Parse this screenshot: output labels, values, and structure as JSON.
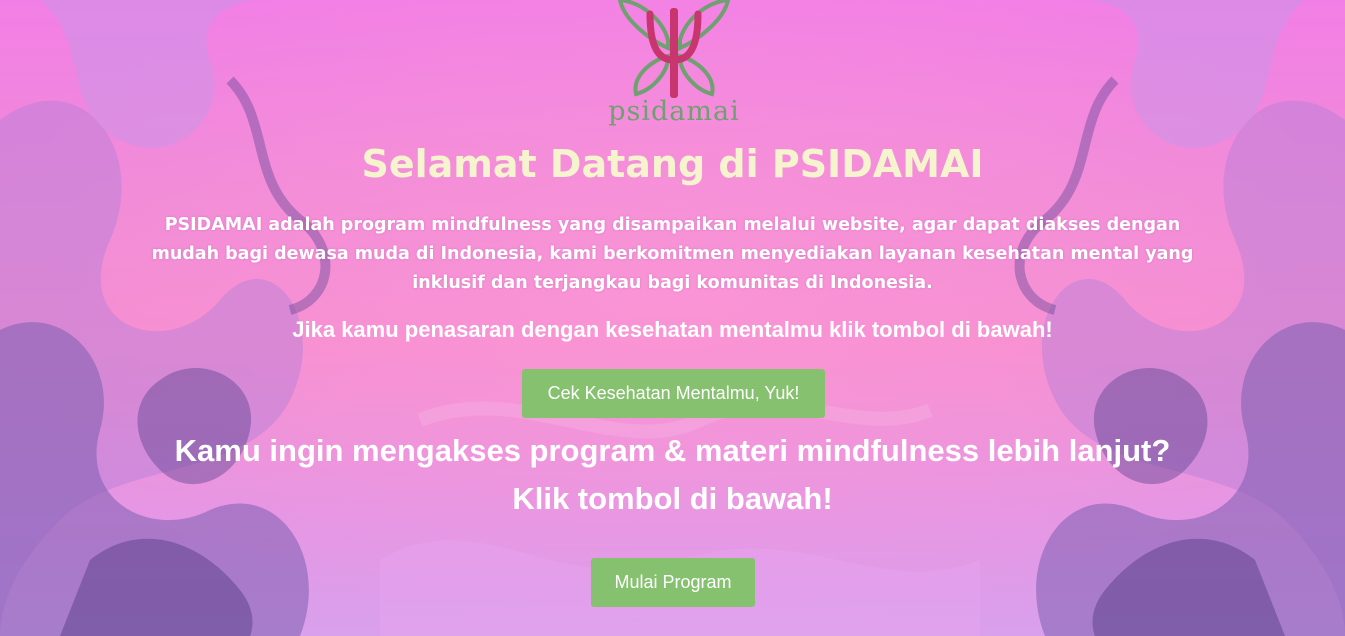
{
  "logo": {
    "text": "psidamai",
    "icon": "butterfly-psi-logo"
  },
  "hero": {
    "title": "Selamat Datang di PSIDAMAI",
    "intro": "PSIDAMAI adalah program mindfulness yang disampaikan melalui website, agar dapat diakses dengan mudah bagi dewasa muda di Indonesia, kami berkomitmen menyediakan layanan kesehatan mental yang inklusif dan terjangkau bagi komunitas di Indonesia.",
    "check_prompt": "Jika kamu penasaran dengan kesehatan mentalmu klik tombol di bawah!",
    "check_button": "Cek Kesehatan Mentalmu, Yuk!",
    "program_prompt": "Kamu ingin mengakses program & materi mindfulness lebih lanjut? Klik tombol di bawah!",
    "program_button": "Mulai Program"
  },
  "colors": {
    "title": "#f6f3cf",
    "button": "#86c16f",
    "logo_green": "#6fa070",
    "logo_magenta": "#c8356f"
  }
}
